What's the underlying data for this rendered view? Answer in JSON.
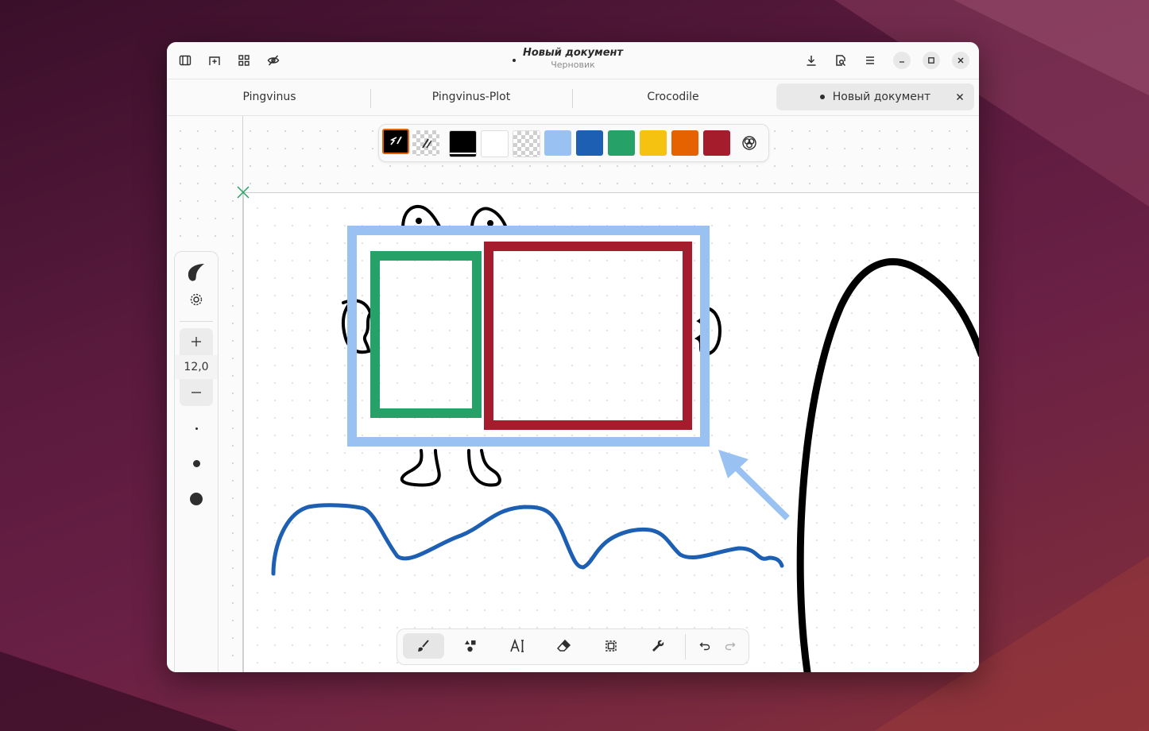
{
  "window": {
    "title": "Новый документ",
    "subtitle": "Черновик"
  },
  "tabs": [
    {
      "label": "Pingvinus"
    },
    {
      "label": "Pingvinus-Plot"
    },
    {
      "label": "Crocodile"
    },
    {
      "label": "Новый документ",
      "active": true
    }
  ],
  "palette": {
    "colors": [
      "#000000",
      "#ffffff",
      "transparent",
      "#99c1f1",
      "#1c5fb3",
      "#26a269",
      "#f5c211",
      "#e66100",
      "#a51d2d"
    ]
  },
  "stroke": {
    "size": "12,0"
  },
  "drawing_colors": {
    "light_blue": "#99c1f1",
    "green": "#26a269",
    "red": "#a51d2d",
    "blue": "#1c5fb3",
    "black": "#000000"
  }
}
